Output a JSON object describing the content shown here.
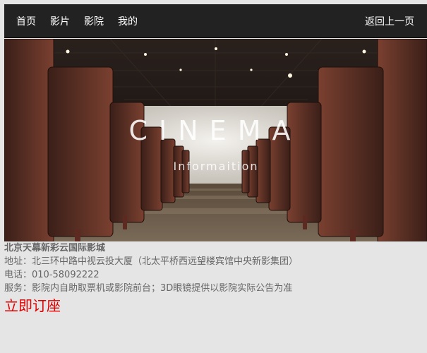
{
  "navbar": {
    "items": [
      {
        "label": "首页"
      },
      {
        "label": "影片"
      },
      {
        "label": "影院"
      },
      {
        "label": "我的"
      }
    ],
    "back_label": "返回上一页",
    "background": "#222222"
  },
  "banner": {
    "title": "CINEMA",
    "subtitle": "Informaition"
  },
  "cinema": {
    "name": "北京天幕新彩云国际影城",
    "address": "地址：北三环中路中视云投大厦（北太平桥西远望楼宾馆中央新影集团）",
    "phone": "电话：010-58092222",
    "service": "服务：影院内自助取票机或影院前台；3D眼镜提供以影院实际公告为准",
    "book_label": "立即订座",
    "book_color": "#e00000"
  }
}
